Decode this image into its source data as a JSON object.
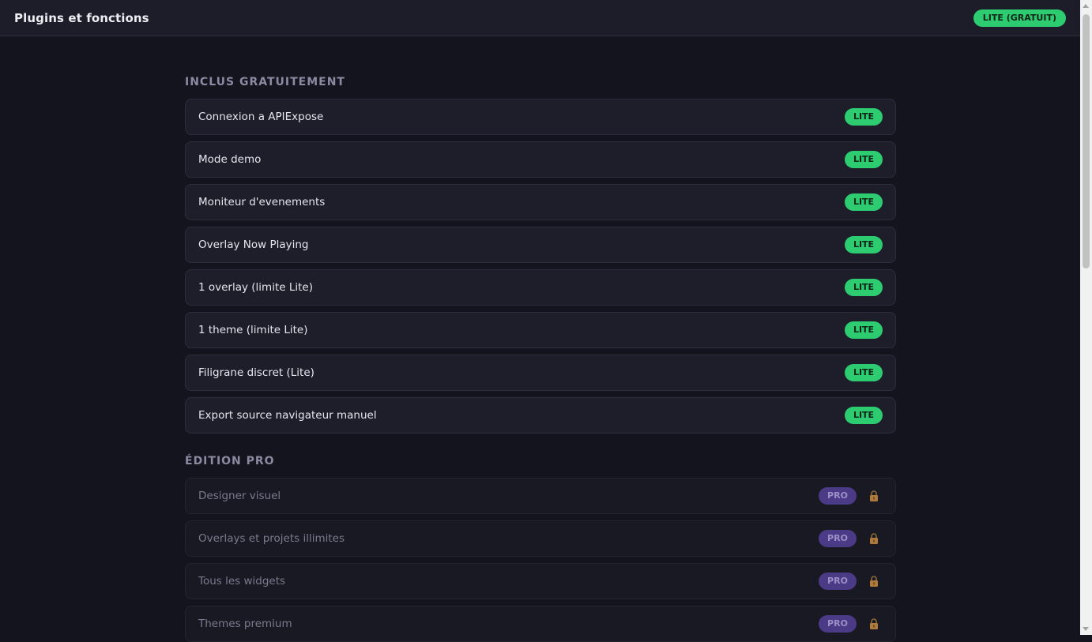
{
  "header": {
    "title": "Plugins et fonctions",
    "tier_badge": "LITE (GRATUIT)"
  },
  "colors": {
    "lite_badge": "#2ecc71",
    "pro_badge": "#4b3a86",
    "background": "#14141e",
    "card": "#1e1e2b"
  },
  "sections": [
    {
      "title": "INCLUS GRATUITEMENT",
      "items": [
        {
          "label": "Connexion a APIExpose",
          "badge": "LITE"
        },
        {
          "label": "Mode demo",
          "badge": "LITE"
        },
        {
          "label": "Moniteur d'evenements",
          "badge": "LITE"
        },
        {
          "label": "Overlay Now Playing",
          "badge": "LITE"
        },
        {
          "label": "1 overlay (limite Lite)",
          "badge": "LITE"
        },
        {
          "label": "1 theme (limite Lite)",
          "badge": "LITE"
        },
        {
          "label": "Filigrane discret (Lite)",
          "badge": "LITE"
        },
        {
          "label": "Export source navigateur manuel",
          "badge": "LITE"
        }
      ]
    },
    {
      "title": "ÉDITION PRO",
      "items": [
        {
          "label": "Designer visuel",
          "badge": "PRO",
          "icon": "lock-icon"
        },
        {
          "label": "Overlays et projets illimites",
          "badge": "PRO",
          "icon": "lock-icon"
        },
        {
          "label": "Tous les widgets",
          "badge": "PRO",
          "icon": "lock-icon"
        },
        {
          "label": "Themes premium",
          "badge": "PRO",
          "icon": "lock-icon"
        }
      ]
    }
  ]
}
